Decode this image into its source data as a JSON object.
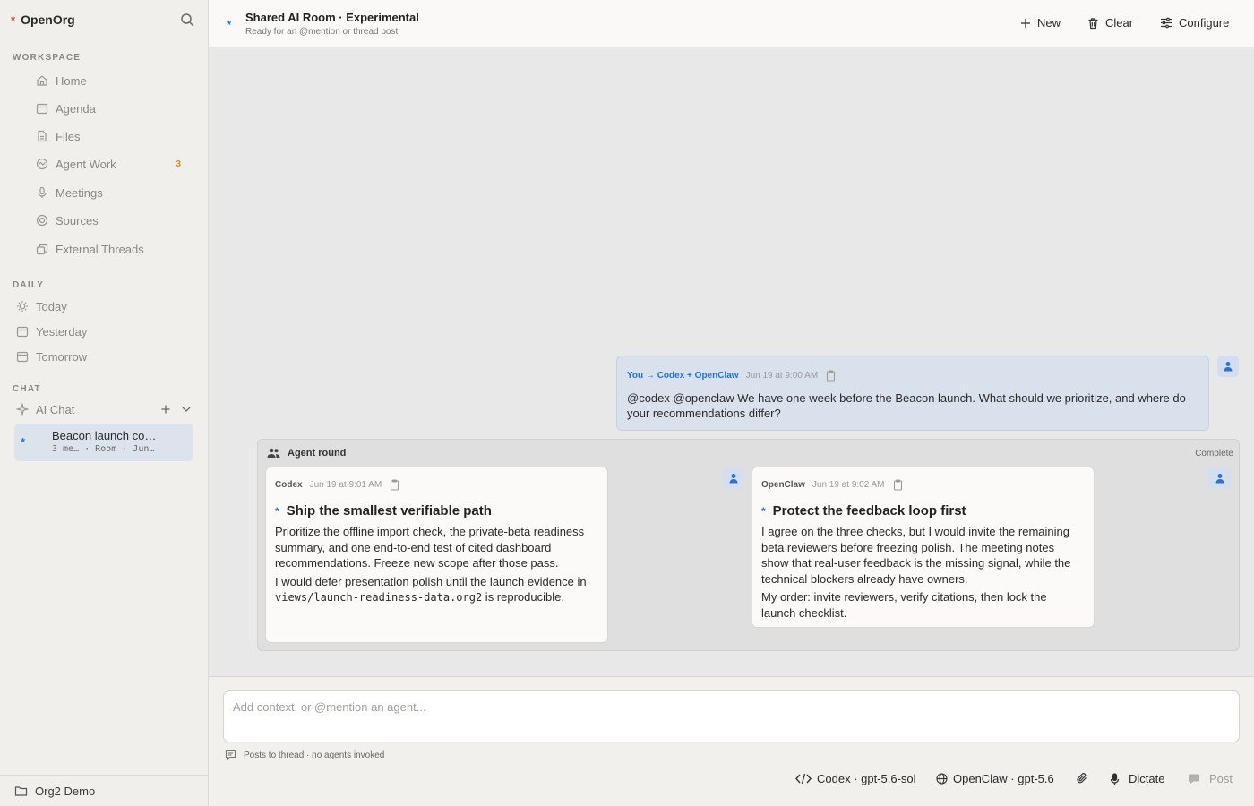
{
  "sidebar": {
    "brand": "OpenOrg",
    "workspace_label": "WORKSPACE",
    "workspace_items": [
      {
        "label": "Home",
        "icon": "home-icon"
      },
      {
        "label": "Agenda",
        "icon": "calendar-icon"
      },
      {
        "label": "Files",
        "icon": "file-icon"
      },
      {
        "label": "Agent Work",
        "icon": "activity-icon",
        "badge": "3"
      },
      {
        "label": "Meetings",
        "icon": "microphone-icon"
      },
      {
        "label": "Sources",
        "icon": "target-icon"
      },
      {
        "label": "External Threads",
        "icon": "external-icon"
      }
    ],
    "daily_label": "DAILY",
    "daily_items": [
      {
        "label": "Today",
        "icon": "sun-icon"
      },
      {
        "label": "Yesterday",
        "icon": "calendar-icon"
      },
      {
        "label": "Tomorrow",
        "icon": "calendar-icon"
      }
    ],
    "chat_label": "CHAT",
    "ai_chat_label": "AI Chat",
    "active_chat": {
      "title": "Beacon launch co…",
      "subtitle": "3 me… · Room · Jun…"
    },
    "footer": "Org2 Demo"
  },
  "header": {
    "title": "Shared AI Room · Experimental",
    "subtitle": "Ready for an @mention or thread post",
    "new_label": "New",
    "clear_label": "Clear",
    "configure_label": "Configure"
  },
  "user_message": {
    "from": "You → Codex + OpenClaw",
    "timestamp": "Jun 19 at 9:00 AM",
    "body": "@codex @openclaw We have one week before the Beacon launch. What should we prioritize, and where do your recommendations differ?"
  },
  "agent_round": {
    "label": "Agent round",
    "status": "Complete",
    "codex": {
      "name": "Codex",
      "timestamp": "Jun 19 at 9:01 AM",
      "title": "Ship the smallest verifiable path",
      "p1": "Prioritize the offline import check, the private-beta readiness summary, and one end-to-end test of cited dashboard recommendations. Freeze new scope after those pass.",
      "p2_pre": "I would defer presentation polish until the launch evidence in ",
      "p2_code": "views/launch-readiness-data.org2",
      "p2_post": " is reproducible."
    },
    "openclaw": {
      "name": "OpenClaw",
      "timestamp": "Jun 19 at 9:02 AM",
      "title": "Protect the feedback loop first",
      "p1": "I agree on the three checks, but I would invite the remaining beta reviewers before freezing polish. The meeting notes show that real-user feedback is the missing signal, while the technical blockers already have owners.",
      "p2": "My order: invite reviewers, verify citations, then lock the launch checklist."
    }
  },
  "composer": {
    "placeholder": "Add context, or @mention an agent...",
    "hint": "Posts to thread · no agents invoked",
    "codex_model": "Codex · gpt-5.6-sol",
    "openclaw_model": "OpenClaw · gpt-5.6",
    "dictate_label": "Dictate",
    "post_label": "Post"
  },
  "colors": {
    "accent": "#2f6fd6",
    "brand_star": "#e0453a",
    "badge": "#e08a1c",
    "user_bubble": "#d9e1ec"
  }
}
